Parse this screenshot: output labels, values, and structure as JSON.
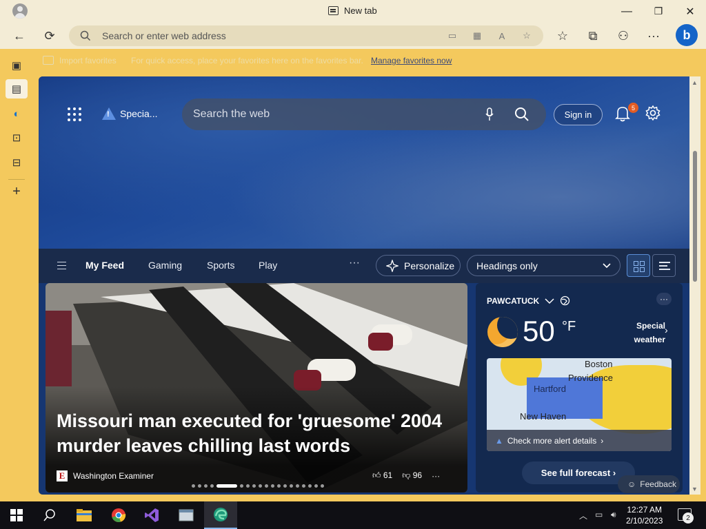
{
  "window": {
    "tab_title": "New tab",
    "minimize": "—",
    "maximize": "❐",
    "close": "✕"
  },
  "toolbar": {
    "back": "←",
    "refresh": "⟳",
    "address_placeholder": "Search or enter web address",
    "more": "···",
    "bing": "b"
  },
  "favorites_bar": {
    "import_label": "Import favorites",
    "hint": "For quick access, place your favorites here on the favorites bar.",
    "manage_link": "Manage favorites now"
  },
  "header": {
    "special_label": "Specia...",
    "search_placeholder": "Search the web",
    "sign_in": "Sign in",
    "notification_count": "5"
  },
  "feed_nav": {
    "items": [
      {
        "label": "My Feed"
      },
      {
        "label": "Gaming"
      },
      {
        "label": "Sports"
      },
      {
        "label": "Play"
      }
    ],
    "more": "···",
    "personalize": "Personalize",
    "headings": "Headings only"
  },
  "article": {
    "headline": "Missouri man executed for 'gruesome' 2004 murder leaves chilling last words",
    "source": "Washington Examiner",
    "source_logo": "E",
    "likes": "61",
    "dislikes": "96",
    "more": "···",
    "carousel_count": 19,
    "carousel_active": 4
  },
  "weather": {
    "location": "PAWCATUCK",
    "more": "···",
    "temperature": "50",
    "unit": "°F",
    "alert_line1": "Special",
    "alert_line2": "weather",
    "map_labels": {
      "boston": "Boston",
      "providence": "Providence",
      "hartford": "Hartford",
      "new_haven": "New Haven"
    },
    "alert_details": "Check more alert details",
    "forecast_button": "See full forecast"
  },
  "feedback": "Feedback",
  "taskbar": {
    "time": "12:27 AM",
    "date": "2/10/2023",
    "notification_count": "2"
  }
}
